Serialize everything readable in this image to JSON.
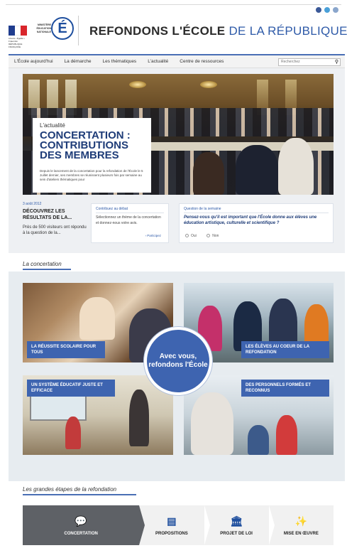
{
  "site": {
    "flag_caption": "Liberté • Égalité • Fraternité RÉPUBLIQUE FRANÇAISE",
    "ministry": "MINISTÈRE ÉDUCATION NATIONALE",
    "logo_letter": "É",
    "title_bold": "REFONDONS L'ÉCOLE",
    "title_rest": "DE LA RÉPUBLIQUE",
    "social_icons": [
      "facebook-icon",
      "twitter-icon",
      "rss-icon"
    ]
  },
  "nav": {
    "items": [
      "L'École aujourd'hui",
      "La démarche",
      "Les thématiques",
      "L'actualité",
      "Centre de ressources"
    ],
    "search_placeholder": "Recherchez"
  },
  "hero": {
    "kicker": "L'actualité",
    "title": "CONCERTATION : CONTRIBUTIONS DES MEMBRES",
    "text": "Depuis le lancement de la concertation pour la refondation de l'École le 5 Juillet dernier, ses membres se réunissent plusieurs fois par semaine au sein d'ateliers thématiques pour"
  },
  "news": {
    "date": "3 août 2012",
    "title": "DÉCOUVREZ LES RÉSULTATS DE LA...",
    "text": "Près de 500 visiteurs ont répondu à la question de la..."
  },
  "contribute": {
    "heading": "Contribuez au débat",
    "text": "Sélectionnez un thème de la concertation et donnez-nous votre avis.",
    "link": "› Participez"
  },
  "question": {
    "heading": "Question de la semaine",
    "text": "Pensez-vous qu'il est important que l'École donne aux élèves une éducation artistique, culturelle et scientifique ?",
    "options": [
      "Oui",
      "Non"
    ]
  },
  "concertation": {
    "section_title": "La concertation",
    "tiles": [
      "LA RÉUSSITE SCOLAIRE POUR TOUS",
      "LES ÉLÈVES AU COEUR DE LA REFONDATION",
      "UN SYSTÈME ÉDUCATIF JUSTE ET EFFICACE",
      "DES PERSONNELS FORMÉS ET RECONNUS"
    ],
    "center_text": "Avec vous, refondons l'École"
  },
  "steps": {
    "section_title": "Les grandes étapes de la refondation",
    "items": [
      {
        "label": "CONCERTATION",
        "icon": "speech-bubble-icon"
      },
      {
        "label": "PROPOSITIONS",
        "icon": "document-icon"
      },
      {
        "label": "PROJET DE LOI",
        "icon": "institution-icon"
      },
      {
        "label": "MISE EN ŒUVRE",
        "icon": "running-figure-icon"
      }
    ]
  },
  "colors": {
    "brand_blue": "#3e64b0",
    "dark_blue": "#1e3c78",
    "active_step": "#5e6166"
  }
}
